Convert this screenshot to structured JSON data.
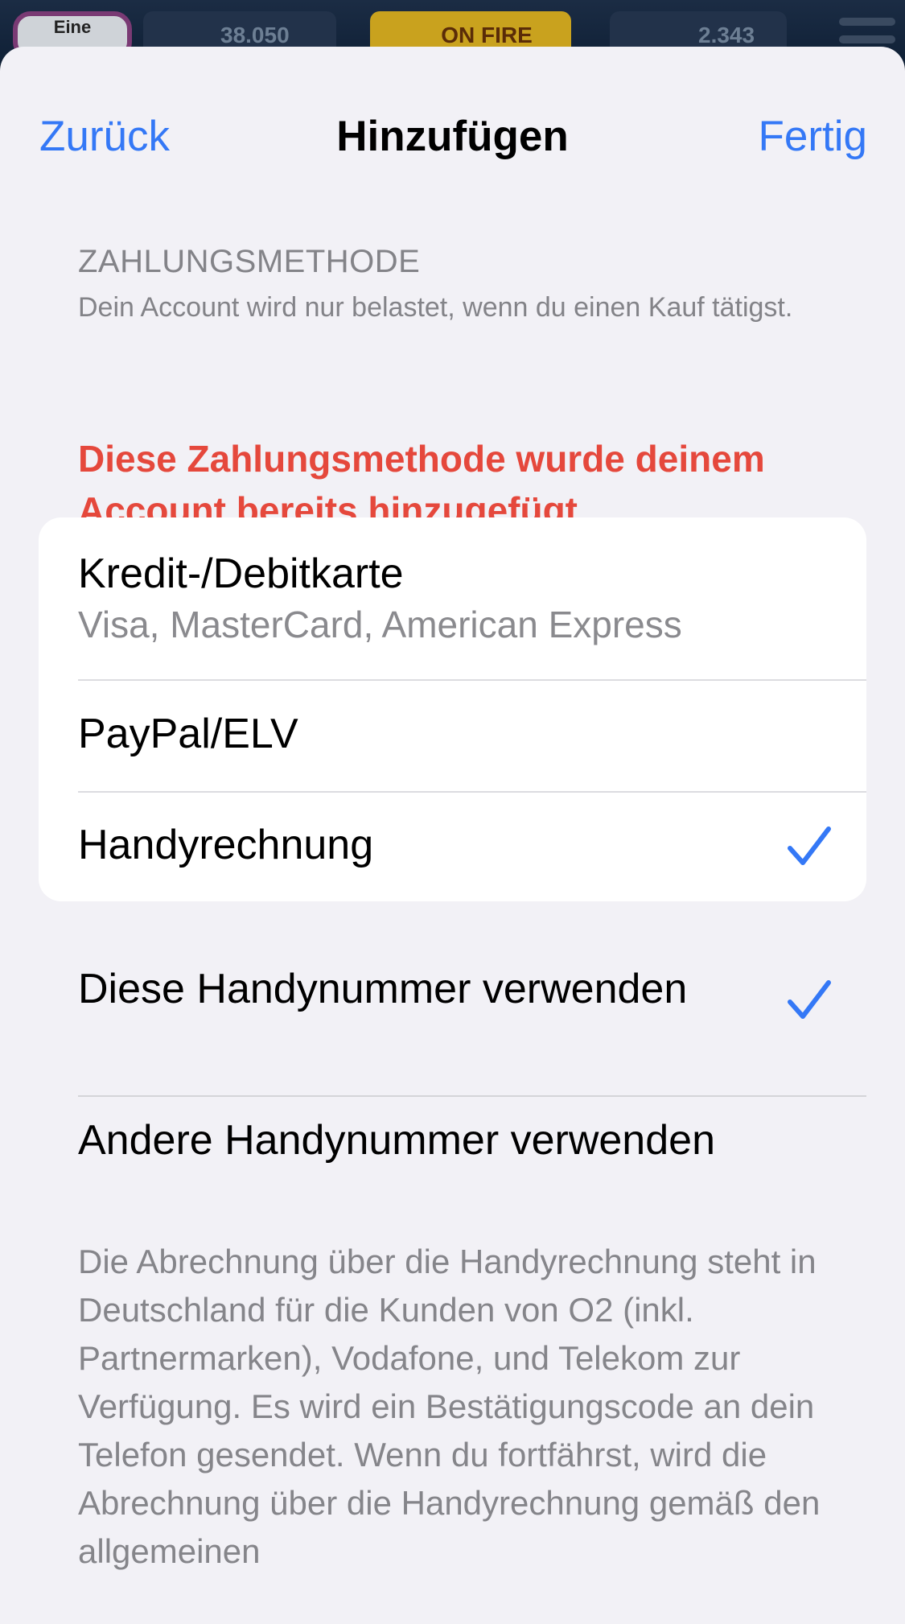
{
  "background": {
    "left_chip": "Eine",
    "score": "38.050",
    "fire": "ON FIRE",
    "coins": "2.343"
  },
  "nav": {
    "back_label": "Zurück",
    "title": "Hinzufügen",
    "done_label": "Fertig"
  },
  "section": {
    "header": "ZAHLUNGSMETHODE",
    "subtitle": "Dein Account wird nur belastet, wenn du einen Kauf tätigst.",
    "error": "Diese Zahlungsmethode wurde deinem Account bereits hinzugefügt."
  },
  "payment_methods": [
    {
      "title": "Kredit-/Debitkarte",
      "subtitle": "Visa, MasterCard, American Express",
      "selected": false
    },
    {
      "title": "PayPal/ELV",
      "selected": false
    },
    {
      "title": "Handyrechnung",
      "selected": true
    }
  ],
  "phone_options": [
    {
      "title": "Diese Handynummer verwenden",
      "selected": true
    },
    {
      "title": "Andere Handynummer verwenden",
      "selected": false
    }
  ],
  "info": "Die Abrechnung über die Handyrechnung steht in Deutschland für die Kunden von O2 (inkl. Partnermarken), Vodafone, und Telekom zur Verfügung. Es wird ein Bestätigungscode an dein Telefon gesendet. Wenn du fortfährst, wird die Abrechnung über die Handyrechnung gemäß den allgemeinen",
  "colors": {
    "accent": "#3478F6",
    "error": "#E5483C",
    "secondary_text": "#838388",
    "sheet_background": "#F2F1F6"
  },
  "icons": {
    "selected_mark": "checkmark-icon"
  }
}
